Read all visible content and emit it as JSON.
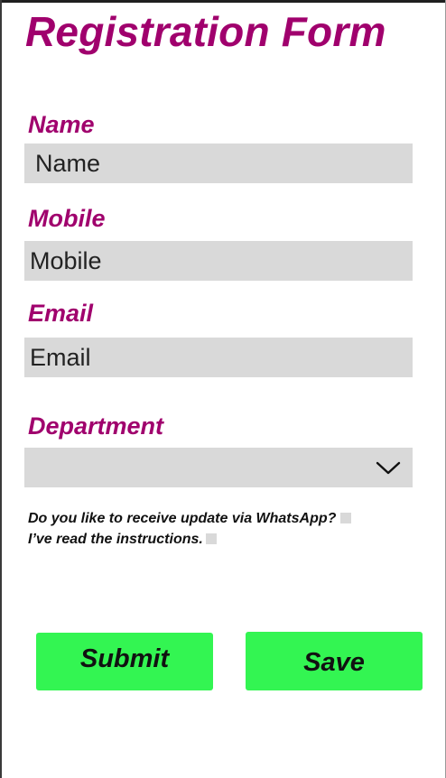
{
  "form": {
    "title": "Registration Form",
    "name_label": "Name",
    "name_placeholder": "Name",
    "mobile_label": "Mobile",
    "mobile_placeholder": "Mobile",
    "email_label": "Email",
    "email_placeholder": "Email",
    "department_label": "Department",
    "department_value": "",
    "whatsapp_text": "Do you like to receive update via WhatsApp?",
    "instructions_text": "I’ve read the instructions.",
    "submit_label": "Submit",
    "save_label": "Save"
  },
  "colors": {
    "title": "#a0006d",
    "field_bg": "#d9d9d9",
    "button_bg": "#33f552"
  },
  "icons": {
    "department_dropdown": "chevron-down-icon"
  }
}
